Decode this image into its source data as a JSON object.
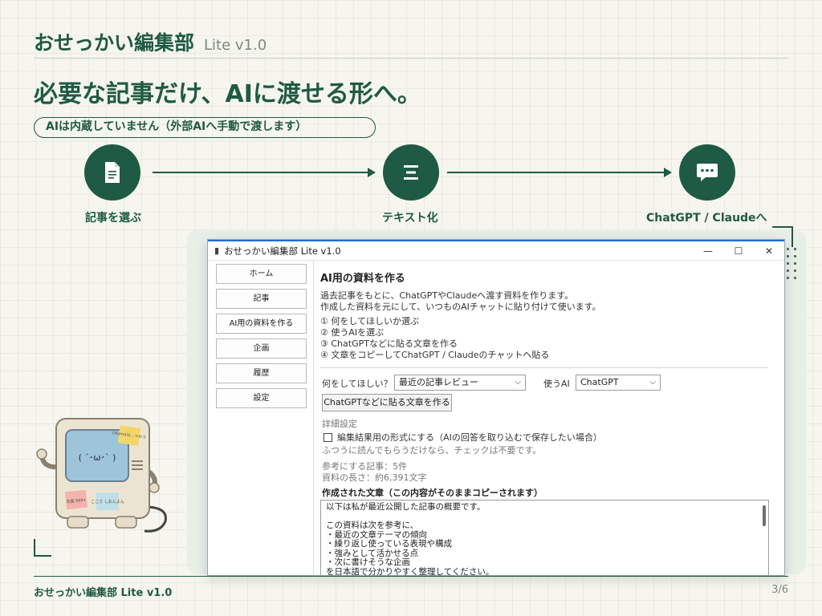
{
  "header": {
    "brand": "おせっかい編集部",
    "version": "Lite v1.0",
    "headline": "必要な記事だけ、AIに渡せる形へ。",
    "notice": "AIは内蔵していません（外部AIへ手動で渡します）"
  },
  "flow": [
    {
      "label": "記事を選ぶ",
      "icon": "document-icon"
    },
    {
      "label": "テキスト化",
      "icon": "text-lines-icon"
    },
    {
      "label": "ChatGPT / Claudeへ",
      "icon": "chat-bubble-icon"
    }
  ],
  "window": {
    "title": "おせっかい編集部 Lite v1.0",
    "controls": {
      "minimize": "—",
      "maximize": "☐",
      "close": "✕"
    },
    "nav": [
      "ホーム",
      "記事",
      "AI用の資料を作る",
      "企画",
      "履歴",
      "設定"
    ],
    "page_title": "AI用の資料を作る",
    "intro": [
      "過去記事をもとに、ChatGPTやClaudeへ渡す資料を作ります。",
      "作成した資料を元にして、いつものAIチャットに貼り付けて使います。"
    ],
    "steps": [
      "① 何をしてほしいか選ぶ",
      "② 使うAIを選ぶ",
      "③ ChatGPTなどに貼る文章を作る",
      "④ 文章をコピーしてChatGPT / Claudeのチャットへ貼る"
    ],
    "purpose_label": "何をしてほしい？",
    "purpose_value": "最近の記事レビュー",
    "ai_label": "使うAI",
    "ai_value": "ChatGPT",
    "generate_button": "ChatGPTなどに貼る文章を作る",
    "advanced_label": "詳細設定",
    "checkbox_label": "編集結果用の形式にする（AIの回答を取り込むで保存したい場合）",
    "checkbox_note": "ふつうに読んでもらうだけなら、チェックは不要です。",
    "ref_count": "参考にする記事：5件",
    "length": "資料の長さ：約6,391文字",
    "output_title": "作成された文章（この内容がそのままコピーされます）",
    "output_lines": [
      "以下は私が最近公開した記事の概要です。",
      "",
      "この資料は次を参考に、",
      "・最近の文章テーマの傾向",
      "・繰り返し使っている表現や構成",
      "・強みとして活かせる点",
      "・次に書けそうな企画",
      "を日本語で分かりやすく整理してください。"
    ]
  },
  "robot": {
    "face": "( ´･ω･` )",
    "note_top": "Ollamaは…つかう",
    "note_left": "支援 999+",
    "note_right": "ここさ しおんよん"
  },
  "footer": {
    "left": "おせっかい編集部 Lite v1.0",
    "page": "3/6"
  },
  "colors": {
    "brand_green": "#1f5a44",
    "background": "#f6f5ee",
    "panel": "#e6efe8"
  }
}
